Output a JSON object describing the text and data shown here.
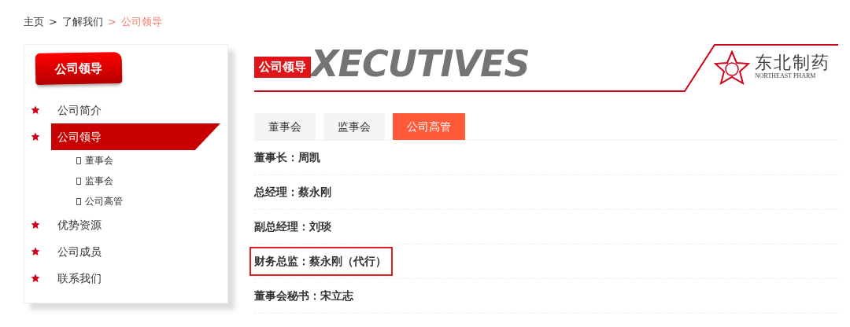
{
  "breadcrumb": [
    {
      "label": "主页",
      "current": false
    },
    {
      "label": "了解我们",
      "current": false
    },
    {
      "label": "公司领导",
      "current": true
    }
  ],
  "breadcrumb_separator": ">",
  "sidebar": {
    "title": "公司领导",
    "items": [
      {
        "label": "公司简介",
        "selected": false
      },
      {
        "label": "公司领导",
        "selected": true,
        "children": [
          {
            "label": "董事会"
          },
          {
            "label": "监事会"
          },
          {
            "label": "公司高管"
          }
        ]
      },
      {
        "label": "优势资源",
        "selected": false
      },
      {
        "label": "公司成员",
        "selected": false
      },
      {
        "label": "联系我们",
        "selected": false
      }
    ]
  },
  "banner": {
    "label": "公司领导",
    "background_text": "XECUTIVES",
    "logo": {
      "name": "东北制药",
      "subtitle": "NORTHEAST PHARM"
    }
  },
  "tabs": [
    {
      "label": "董事会",
      "selected": false
    },
    {
      "label": "监事会",
      "selected": false
    },
    {
      "label": "公司高管",
      "selected": true
    }
  ],
  "executives": [
    {
      "text": "董事长：周凯",
      "highlighted": false
    },
    {
      "text": "总经理：蔡永刚",
      "highlighted": false
    },
    {
      "text": "副总经理：刘琰",
      "highlighted": false
    },
    {
      "text": "财务总监：蔡永刚（代行）",
      "highlighted": true
    },
    {
      "text": "董事会秘书：宋立志",
      "highlighted": false
    }
  ]
}
